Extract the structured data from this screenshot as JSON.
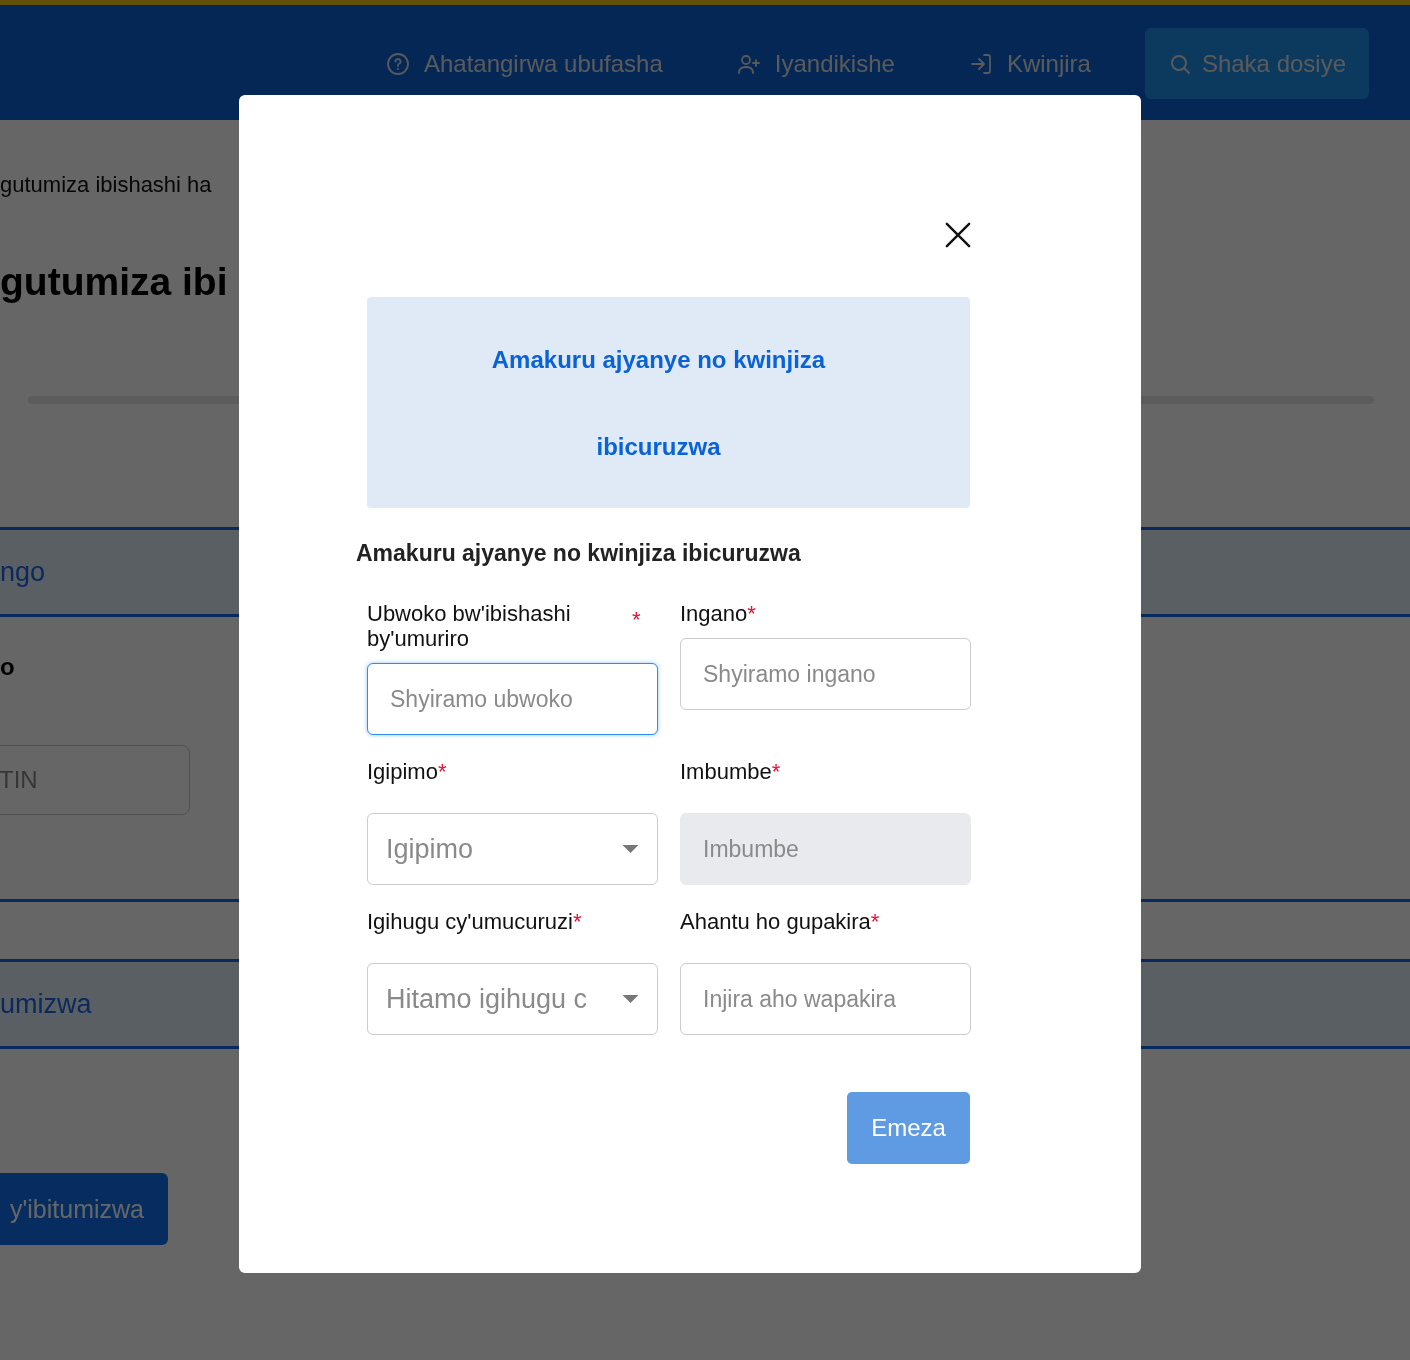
{
  "header": {
    "nav": [
      {
        "label": "Ahatangirwa ubufasha"
      },
      {
        "label": "Iyandikishe"
      },
      {
        "label": "Kwinjira"
      }
    ],
    "search_button": "Shaka dosiye"
  },
  "background": {
    "breadcrumb": "gutumiza ibishashi ha",
    "heading": "gutumiza ibi",
    "section_1": "ngo",
    "label": "o",
    "tin_field": {
      "placeholder": "TIN"
    },
    "section_2": "umizwa",
    "button": "y'ibitumizwa"
  },
  "modal": {
    "banner": "Amakuru ajyanye no kwinjiza ibicuruzwa",
    "title": "Amakuru ajyanye no kwinjiza ibicuruzwa",
    "fields": [
      {
        "label": "Ubwoko bw'ibishashi by'umuriro",
        "required_mark": "*",
        "kind": "text",
        "placeholder": "Shyiramo ubwoko",
        "focused": true,
        "disabled": false
      },
      {
        "label": "Ingano",
        "required_mark": "*",
        "kind": "text",
        "placeholder": "Shyiramo ingano",
        "focused": false,
        "disabled": false
      },
      {
        "label": "Igipimo",
        "required_mark": "*",
        "kind": "select",
        "placeholder": "Igipimo",
        "focused": false,
        "disabled": false
      },
      {
        "label": "Imbumbe",
        "required_mark": "*",
        "kind": "text",
        "placeholder": "Imbumbe",
        "focused": false,
        "disabled": true
      },
      {
        "label": "Igihugu cy'umucuruzi",
        "required_mark": "*",
        "kind": "select",
        "placeholder": "Hitamo igihugu c",
        "focused": false,
        "disabled": false
      },
      {
        "label": "Ahantu ho gupakira",
        "required_mark": "*",
        "kind": "text",
        "placeholder": "Injira aho wapakira",
        "focused": false,
        "disabled": false
      }
    ],
    "submit": "Emeza"
  }
}
